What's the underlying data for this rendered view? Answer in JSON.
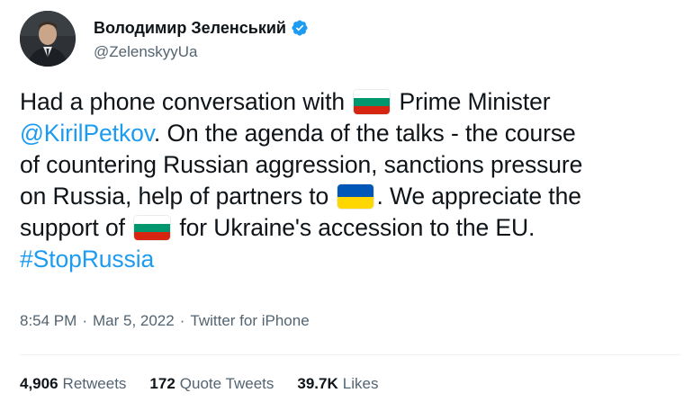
{
  "author": {
    "display_name": "Володимир Зеленський",
    "handle": "@ZelenskyyUa",
    "verified_icon": "verified-badge-icon",
    "avatar": "profile-photo"
  },
  "tweet": {
    "text_before_flag1": "Had a phone conversation with",
    "text_after_flag1": "Prime Minister",
    "mention": "@KirilPetkov",
    "line2_rest": ". On the agenda of the talks - the course",
    "line3": "of countering Russian aggression, sanctions pressure",
    "line4_before_flag": "on Russia, help of partners to",
    "line4_after_flag": ". We appreciate the",
    "line5_before_flag": "support of",
    "line5_after_flag": "for Ukraine's accession to the EU.",
    "hashtag": "#StopRussia",
    "flags": [
      "bulgaria-flag",
      "ukraine-flag",
      "bulgaria-flag"
    ]
  },
  "meta": {
    "time": "8:54 PM",
    "separator": "·",
    "date": "Mar 5, 2022",
    "source": "Twitter for iPhone"
  },
  "stats": {
    "retweets_count": "4,906",
    "retweets_label": "Retweets",
    "quote_count": "172",
    "quote_label": "Quote Tweets",
    "likes_count": "39.7K",
    "likes_label": "Likes"
  },
  "colors": {
    "link": "#1d9bf0",
    "secondary_text": "#536471",
    "verified": "#1d9bf0"
  }
}
